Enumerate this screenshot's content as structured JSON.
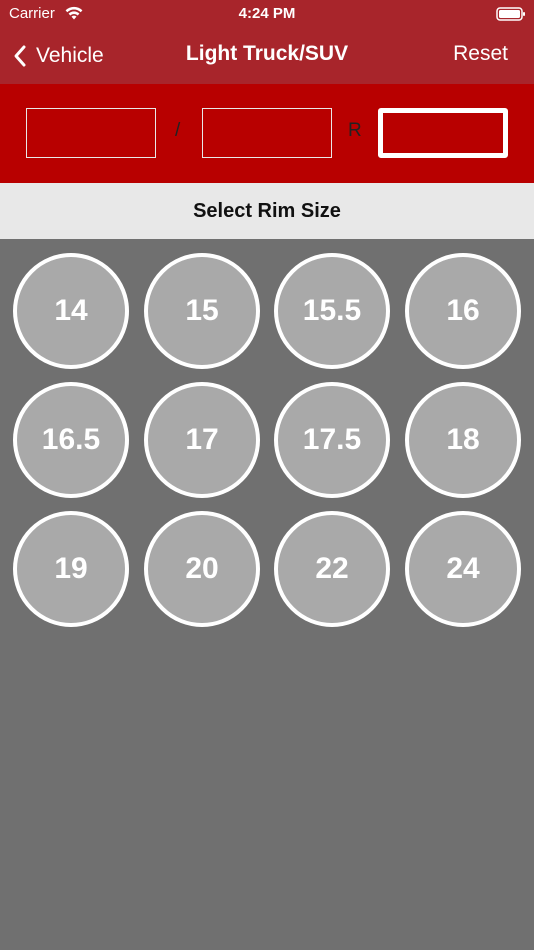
{
  "status": {
    "carrier": "Carrier",
    "time": "4:24 PM"
  },
  "nav": {
    "back_label": "Vehicle",
    "title": "Light Truck/SUV",
    "reset_label": "Reset"
  },
  "size_input": {
    "width_value": "",
    "aspect_value": "",
    "slash": "/",
    "r_label": "R",
    "rim_value": ""
  },
  "section": {
    "title": "Select Rim Size"
  },
  "rims": [
    "14",
    "15",
    "15.5",
    "16",
    "16.5",
    "17",
    "17.5",
    "18",
    "19",
    "20",
    "22",
    "24"
  ],
  "colors": {
    "nav_bg": "#a8252b",
    "input_bar_bg": "#b80000",
    "header_bg": "#e8e8e8",
    "grid_bg": "#707070",
    "rim_fill": "#a9a9a9"
  }
}
